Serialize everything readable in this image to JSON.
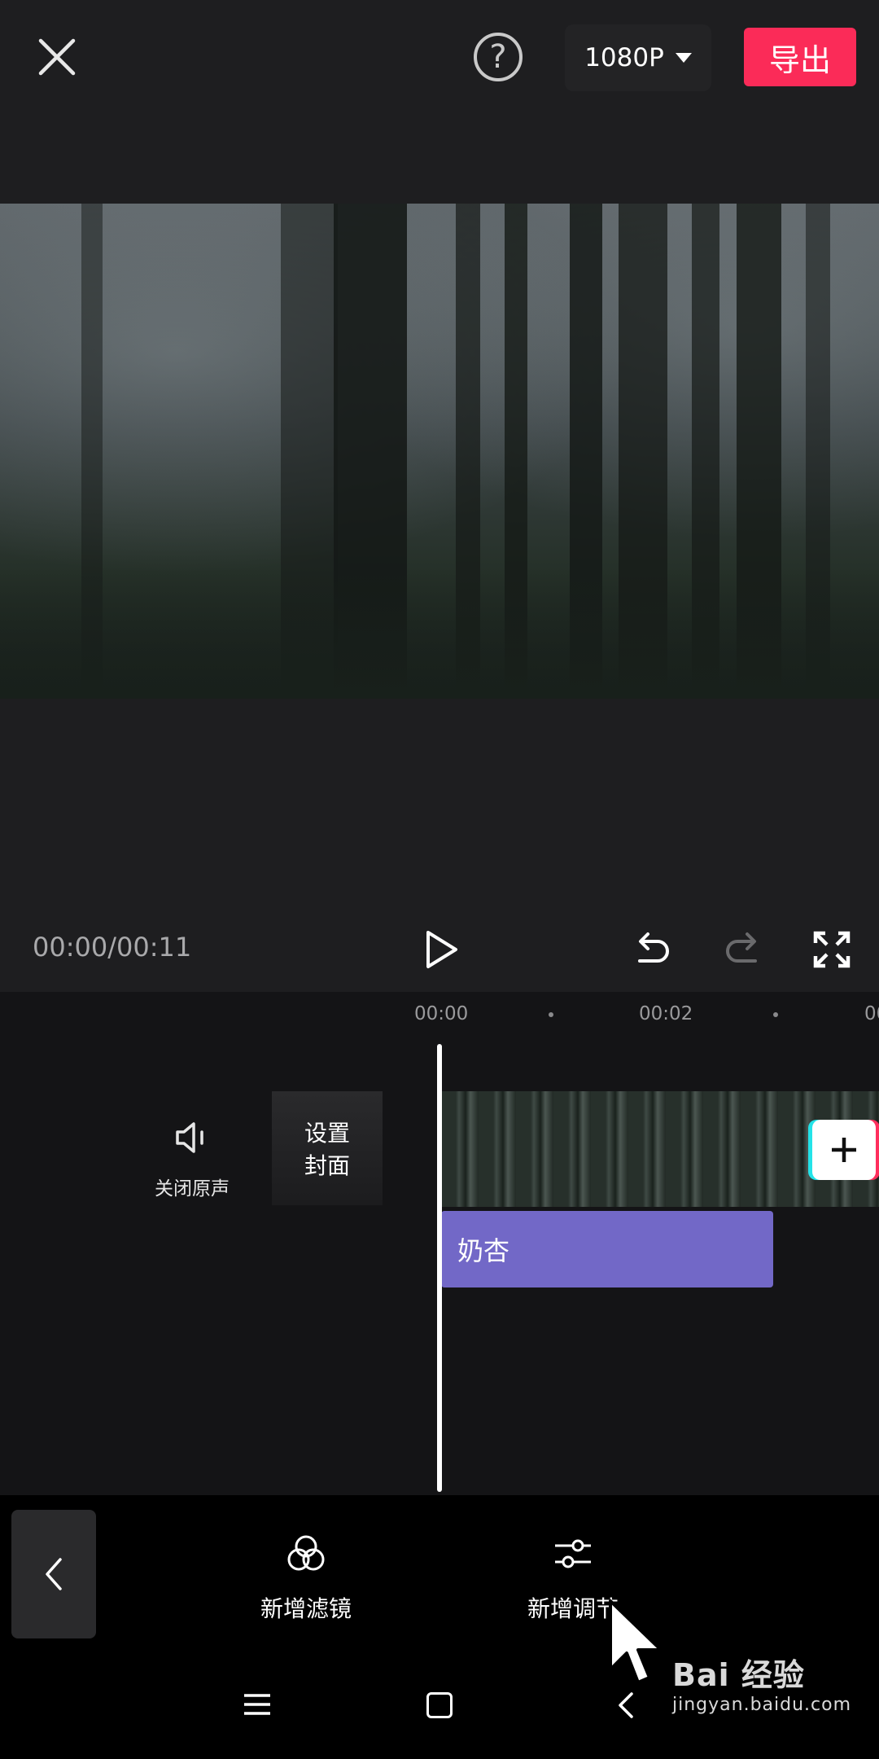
{
  "header": {
    "close_icon": "close-icon",
    "help_icon": "help-icon",
    "help_symbol": "?",
    "resolution": "1080P",
    "export_label": "导出",
    "export_color": "#fb2b58"
  },
  "player": {
    "timecode": "00:00/00:11"
  },
  "timeline": {
    "ruler": [
      "00:00",
      "00:02",
      "00"
    ],
    "mute_label": "关闭原声",
    "cover_label_line1": "设置",
    "cover_label_line2": "封面",
    "sticker_label": "奶杏",
    "sticker_color": "#7268c7"
  },
  "toolbar": {
    "items": [
      {
        "label": "新增滤镜",
        "icon": "filter-icon"
      },
      {
        "label": "新增调节",
        "icon": "adjust-icon"
      }
    ]
  },
  "watermark": {
    "main": "Bai 经验",
    "sub": "jingyan.baidu.com"
  }
}
